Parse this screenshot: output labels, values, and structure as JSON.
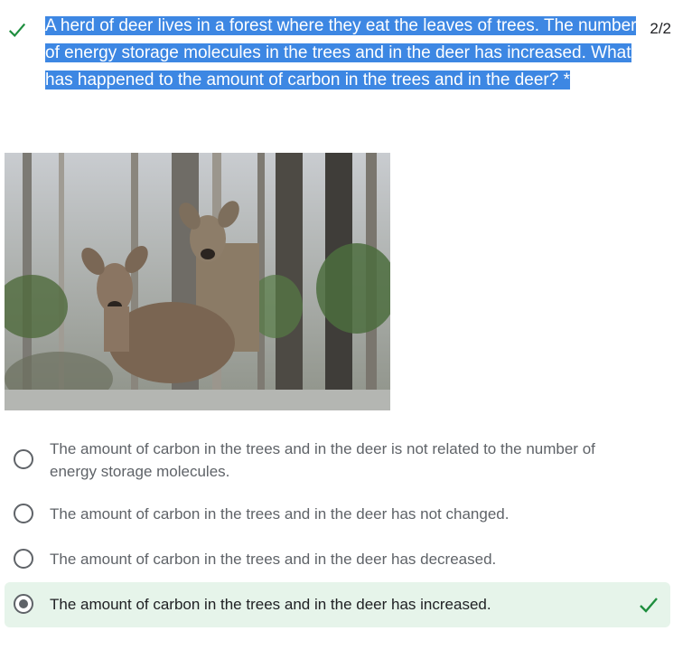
{
  "question": {
    "text": "A herd of deer lives in a forest where they eat the leaves of trees. The number of energy storage molecules in the trees and in the deer has increased. What has happened to the amount of carbon in the trees and in the deer? *",
    "score": "2/2",
    "status_icon": "check-icon",
    "highlight_color": "#3d87e3"
  },
  "image": {
    "description_icon": "deer-photo"
  },
  "options": [
    {
      "label": "The amount of carbon in the trees and in the deer is not related to the number of energy storage molecules.",
      "selected": false
    },
    {
      "label": "The amount of carbon in the trees and in the deer has not changed.",
      "selected": false
    },
    {
      "label": "The amount of carbon in the trees and in the deer has decreased.",
      "selected": false
    },
    {
      "label": "The amount of carbon in the trees and in the deer has increased.",
      "selected": true,
      "correct": true
    }
  ],
  "colors": {
    "correct_bg": "#e6f4ea",
    "check_green": "#1e8e3e"
  }
}
